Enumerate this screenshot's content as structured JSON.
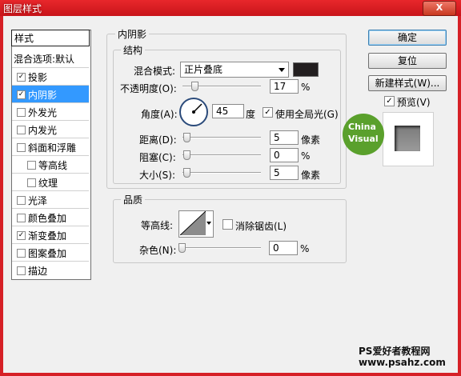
{
  "window": {
    "title": "图层样式",
    "close": "X"
  },
  "sidebar": {
    "header": "样式",
    "blend_options": "混合选项:默认",
    "items": [
      {
        "label": "投影",
        "checked": true,
        "selected": false
      },
      {
        "label": "内阴影",
        "checked": true,
        "selected": true
      },
      {
        "label": "外发光",
        "checked": false,
        "selected": false
      },
      {
        "label": "内发光",
        "checked": false,
        "selected": false
      },
      {
        "label": "斜面和浮雕",
        "checked": false,
        "selected": false
      },
      {
        "label": "等高线",
        "checked": false,
        "selected": false,
        "indent": true
      },
      {
        "label": "纹理",
        "checked": false,
        "selected": false,
        "indent": true
      },
      {
        "label": "光泽",
        "checked": false,
        "selected": false
      },
      {
        "label": "颜色叠加",
        "checked": false,
        "selected": false
      },
      {
        "label": "渐变叠加",
        "checked": true,
        "selected": false
      },
      {
        "label": "图案叠加",
        "checked": false,
        "selected": false
      },
      {
        "label": "描边",
        "checked": false,
        "selected": false
      }
    ]
  },
  "panel": {
    "title": "内阴影",
    "structure": {
      "title": "结构",
      "blend_mode_label": "混合模式:",
      "blend_mode_value": "正片叠底",
      "shadow_color": "#231f20",
      "opacity_label": "不透明度(O):",
      "opacity_value": "17",
      "opacity_unit": "%",
      "angle_label": "角度(A):",
      "angle_value": "45",
      "angle_unit": "度",
      "global_light_label": "使用全局光(G)",
      "global_light_checked": true,
      "distance_label": "距离(D):",
      "distance_value": "5",
      "distance_unit": "像素",
      "choke_label": "阻塞(C):",
      "choke_value": "0",
      "choke_unit": "%",
      "size_label": "大小(S):",
      "size_value": "5",
      "size_unit": "像素"
    },
    "quality": {
      "title": "品质",
      "contour_label": "等高线:",
      "antialias_label": "消除锯齿(L)",
      "antialias_checked": false,
      "noise_label": "杂色(N):",
      "noise_value": "0",
      "noise_unit": "%"
    }
  },
  "buttons": {
    "ok": "确定",
    "reset": "复位",
    "new_style": "新建样式(W)...",
    "preview_label": "预览(V)",
    "preview_checked": true
  },
  "logo": {
    "line1": "China",
    "line2": "Visual"
  },
  "watermark": {
    "line1": "PS爱好者教程网",
    "line2": "www.psahz.com"
  }
}
